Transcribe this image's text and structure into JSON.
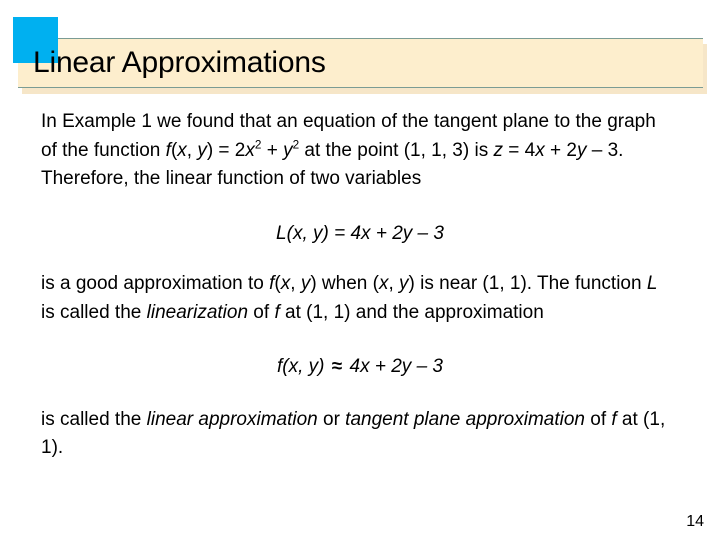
{
  "slide": {
    "title": "Linear Approximations",
    "page_number": "14",
    "accent_color": "#00b0f0",
    "title_bar_color": "#fdeecd",
    "title_bar_border_color": "#7b9c94",
    "background_color": "#ffffff"
  },
  "body": {
    "paragraph1": {
      "text_full": "In Example 1 we found that an equation of the tangent plane to the graph of the function f(x, y) = 2x2 + y2 at the point (1, 1, 3) is z = 4x + 2y – 3. Therefore, the linear function of two variables",
      "seg1": "In Example 1 we found that an equation of the tangent ",
      "seg2": "plane to the graph of the function ",
      "fn_f": "f",
      "fn_open": "(",
      "fn_x": "x",
      "fn_comma": ", ",
      "fn_y": "y",
      "fn_close": ")",
      "equals": " = 2",
      "term_x": "x",
      "exp_2a": "2",
      "plus": " + ",
      "term_y": "y",
      "exp_2b": "2",
      "seg3": " at the ",
      "seg4": "point (1, 1, 3) is ",
      "var_z": "z",
      "eq2": " = 4",
      "var_x2": "x",
      "plus2": " + 2",
      "var_y2": "y",
      "minus3": " – 3. Therefore, the linear ",
      "seg5": "function of two variables"
    },
    "formula1": {
      "text_full": "L(x, y) = 4x + 2y – 3",
      "lhs_L": "L",
      "lhs_open": "(",
      "lhs_x": "x",
      "lhs_comma": ", ",
      "lhs_y": "y",
      "lhs_close": ")",
      "rhs": " = 4x + 2y – 3"
    },
    "paragraph2": {
      "text_full": "is a good approximation to f(x, y) when (x, y) is near (1, 1). The function L is called the linearization of f at (1, 1) and the approximation",
      "seg1": "is a good approximation to ",
      "f1": "f",
      "p1_open": "(",
      "p1_x": "x",
      "p1_comma": ", ",
      "p1_y": "y",
      "p1_close": ")",
      "seg2": " when (",
      "p2_x": "x",
      "p2_comma": ", ",
      "p2_y": "y",
      "p2_close": ")",
      "seg3": " is near (1, 1). ",
      "seg4": "The function ",
      "var_L": "L",
      "seg5": " is called the ",
      "em_linearization": "linearization",
      "seg6": " of ",
      "var_f2": "f",
      "seg7": " at (1, 1) and ",
      "seg8": "the approximation"
    },
    "formula2": {
      "text_full": "f(x, y) ≈ 4x + 2y – 3",
      "lhs_f": "f",
      "lhs_open": "(",
      "lhs_x": "x",
      "lhs_comma": ", ",
      "lhs_y": "y",
      "lhs_close": ")",
      "approx_symbol": "≈",
      "rhs": " 4x + 2y – 3"
    },
    "paragraph3": {
      "text_full": "is called the linear approximation or tangent plane approximation of f at (1, 1).",
      "seg1": "is called the ",
      "em1": "linear approximation",
      "seg2": " or ",
      "em2": "tangent plane",
      "seg3": " ",
      "em3": "approximation",
      "seg4": " of ",
      "var_f": "f",
      "seg5": " at (1, 1)."
    }
  }
}
